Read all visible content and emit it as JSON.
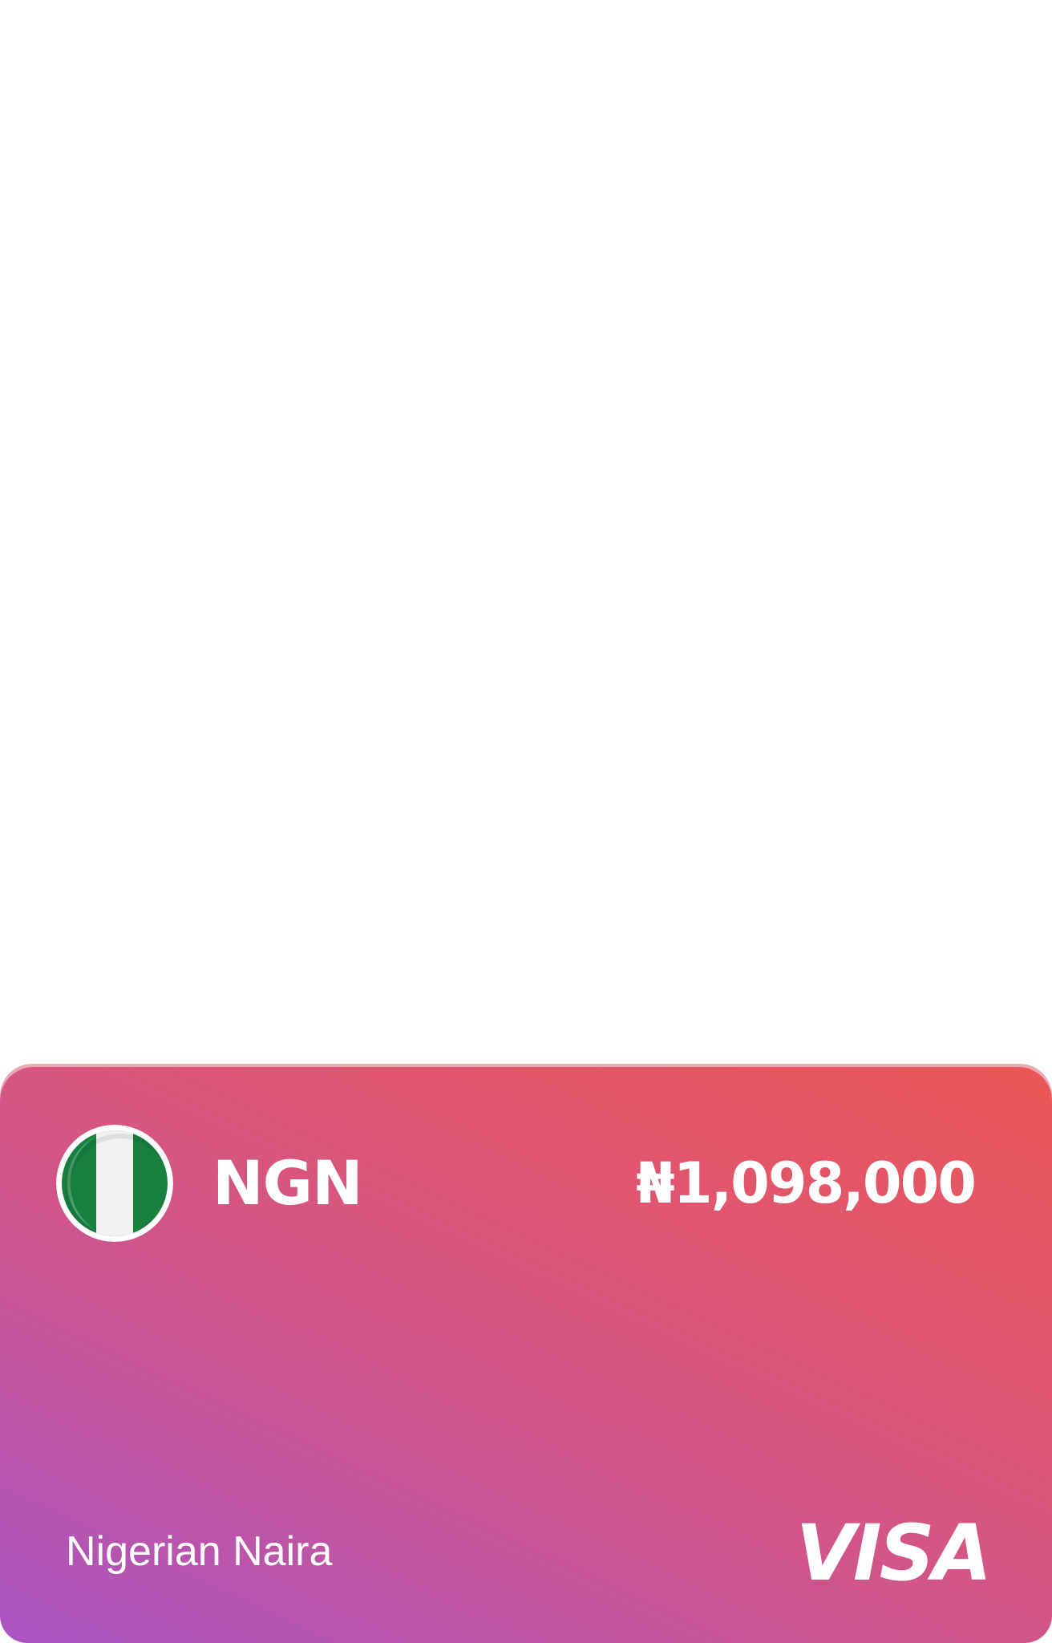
{
  "card": {
    "currency_code": "NGN",
    "balance": "₦1,098,000",
    "currency_name": "Nigerian Naira",
    "network": "VISA",
    "flag_icon": "nigeria-flag-icon",
    "colors": {
      "gradient_top_right": "#ea5756",
      "gradient_bottom_left": "#a955c4",
      "flag_green": "#17803f",
      "flag_white": "#f1f1f1",
      "text": "#ffffff"
    }
  }
}
